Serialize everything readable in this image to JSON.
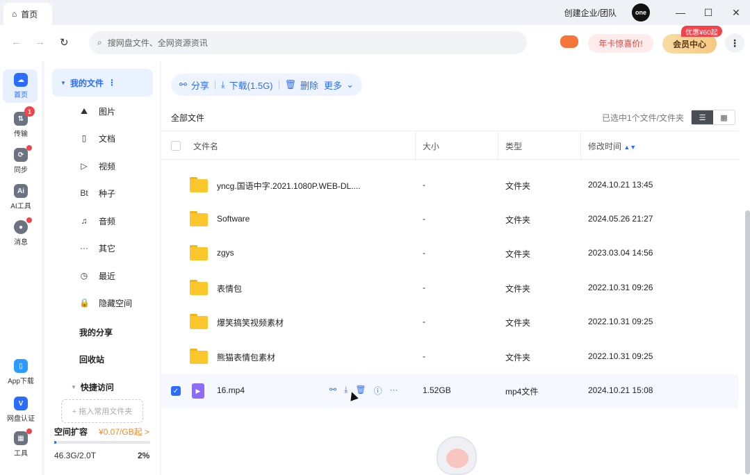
{
  "titlebar": {
    "tab_label": "首页",
    "create_enterprise": "创建企业/团队",
    "avatar_text": "one"
  },
  "addressbar": {
    "search_placeholder": "搜网盘文件、全网资源资讯",
    "promo": "年卡惊喜价!",
    "vip": "会员中心",
    "vip_badge": "优惠¥60起"
  },
  "rail": {
    "items": [
      {
        "label": "首页",
        "icon": "cloud-home-icon"
      },
      {
        "label": "传输",
        "icon": "transfer-icon",
        "badge": "1"
      },
      {
        "label": "同步",
        "icon": "sync-icon"
      },
      {
        "label": "AI工具",
        "icon": "ai-tool-icon"
      },
      {
        "label": "消息",
        "icon": "message-icon"
      },
      {
        "label": "App下载",
        "icon": "app-download-icon"
      },
      {
        "label": "网盘认证",
        "icon": "verify-icon"
      },
      {
        "label": "工具",
        "icon": "tools-icon"
      }
    ]
  },
  "sidebar": {
    "my_files": "我的文件",
    "items": [
      {
        "label": "图片",
        "icon": "image-icon"
      },
      {
        "label": "文档",
        "icon": "doc-icon"
      },
      {
        "label": "视频",
        "icon": "video-icon"
      },
      {
        "label": "种子",
        "icon": "bt-icon"
      },
      {
        "label": "音频",
        "icon": "audio-icon"
      },
      {
        "label": "其它",
        "icon": "other-icon"
      },
      {
        "label": "最近",
        "icon": "recent-icon"
      },
      {
        "label": "隐藏空间",
        "icon": "lock-icon"
      }
    ],
    "my_share": "我的分享",
    "recycle": "回收站",
    "quick_access": "快捷访问",
    "add_folder": "+ 拖入常用文件夹",
    "space_label": "空间扩容",
    "space_price": "¥0.07/GB起 >",
    "space_used": "46.3G/2.0T",
    "space_pct": "2%",
    "space_fraction": 0.02
  },
  "toolbar": {
    "share": "分享",
    "download": "下载(1.5G)",
    "delete": "删除",
    "more": "更多"
  },
  "main": {
    "crumb": "全部文件",
    "selection_info": "已选中1个文件/文件夹"
  },
  "table": {
    "headers": {
      "name": "文件名",
      "size": "大小",
      "type": "类型",
      "mtime": "修改时间"
    },
    "rows": [
      {
        "name": "yncg.国语中字.2021.1080P.WEB-DL....",
        "size": "-",
        "type": "文件夹",
        "mtime": "2024.10.21 13:45",
        "kind": "folder"
      },
      {
        "name": "Software",
        "size": "-",
        "type": "文件夹",
        "mtime": "2024.05.26 21:27",
        "kind": "folder"
      },
      {
        "name": "zgys",
        "size": "-",
        "type": "文件夹",
        "mtime": "2023.03.04 14:56",
        "kind": "folder"
      },
      {
        "name": "表情包",
        "size": "-",
        "type": "文件夹",
        "mtime": "2022.10.31 09:26",
        "kind": "folder"
      },
      {
        "name": "爆笑搞笑视频素材",
        "size": "-",
        "type": "文件夹",
        "mtime": "2022.10.31 09:25",
        "kind": "folder"
      },
      {
        "name": "熊猫表情包素材",
        "size": "-",
        "type": "文件夹",
        "mtime": "2022.10.31 09:25",
        "kind": "folder"
      },
      {
        "name": "16.mp4",
        "size": "1.52GB",
        "type": "mp4文件",
        "mtime": "2024.10.21 15:08",
        "kind": "video"
      }
    ]
  }
}
